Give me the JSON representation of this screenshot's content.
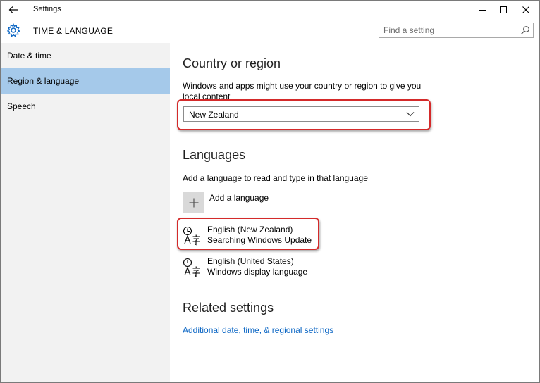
{
  "window": {
    "title": "Settings"
  },
  "header": {
    "title": "TIME & LANGUAGE",
    "search_placeholder": "Find a setting"
  },
  "sidebar": {
    "items": [
      {
        "label": "Date & time",
        "selected": false
      },
      {
        "label": "Region & language",
        "selected": true
      },
      {
        "label": "Speech",
        "selected": false
      }
    ]
  },
  "region": {
    "heading": "Country or region",
    "description_line1": "Windows and apps might use your country or region to give you",
    "description_line2": "local content",
    "selected_country": "New Zealand"
  },
  "languages": {
    "heading": "Languages",
    "description": "Add a language to read and type in that language",
    "add_label": "Add a language",
    "items": [
      {
        "name": "English (New Zealand)",
        "status": "Searching Windows Update"
      },
      {
        "name": "English (United States)",
        "status": "Windows display language"
      }
    ]
  },
  "related": {
    "heading": "Related settings",
    "link": "Additional date, time, & regional settings"
  },
  "colors": {
    "selected_nav": "#a5c9ea",
    "highlight": "#d42a2a",
    "link": "#0b66c4"
  }
}
